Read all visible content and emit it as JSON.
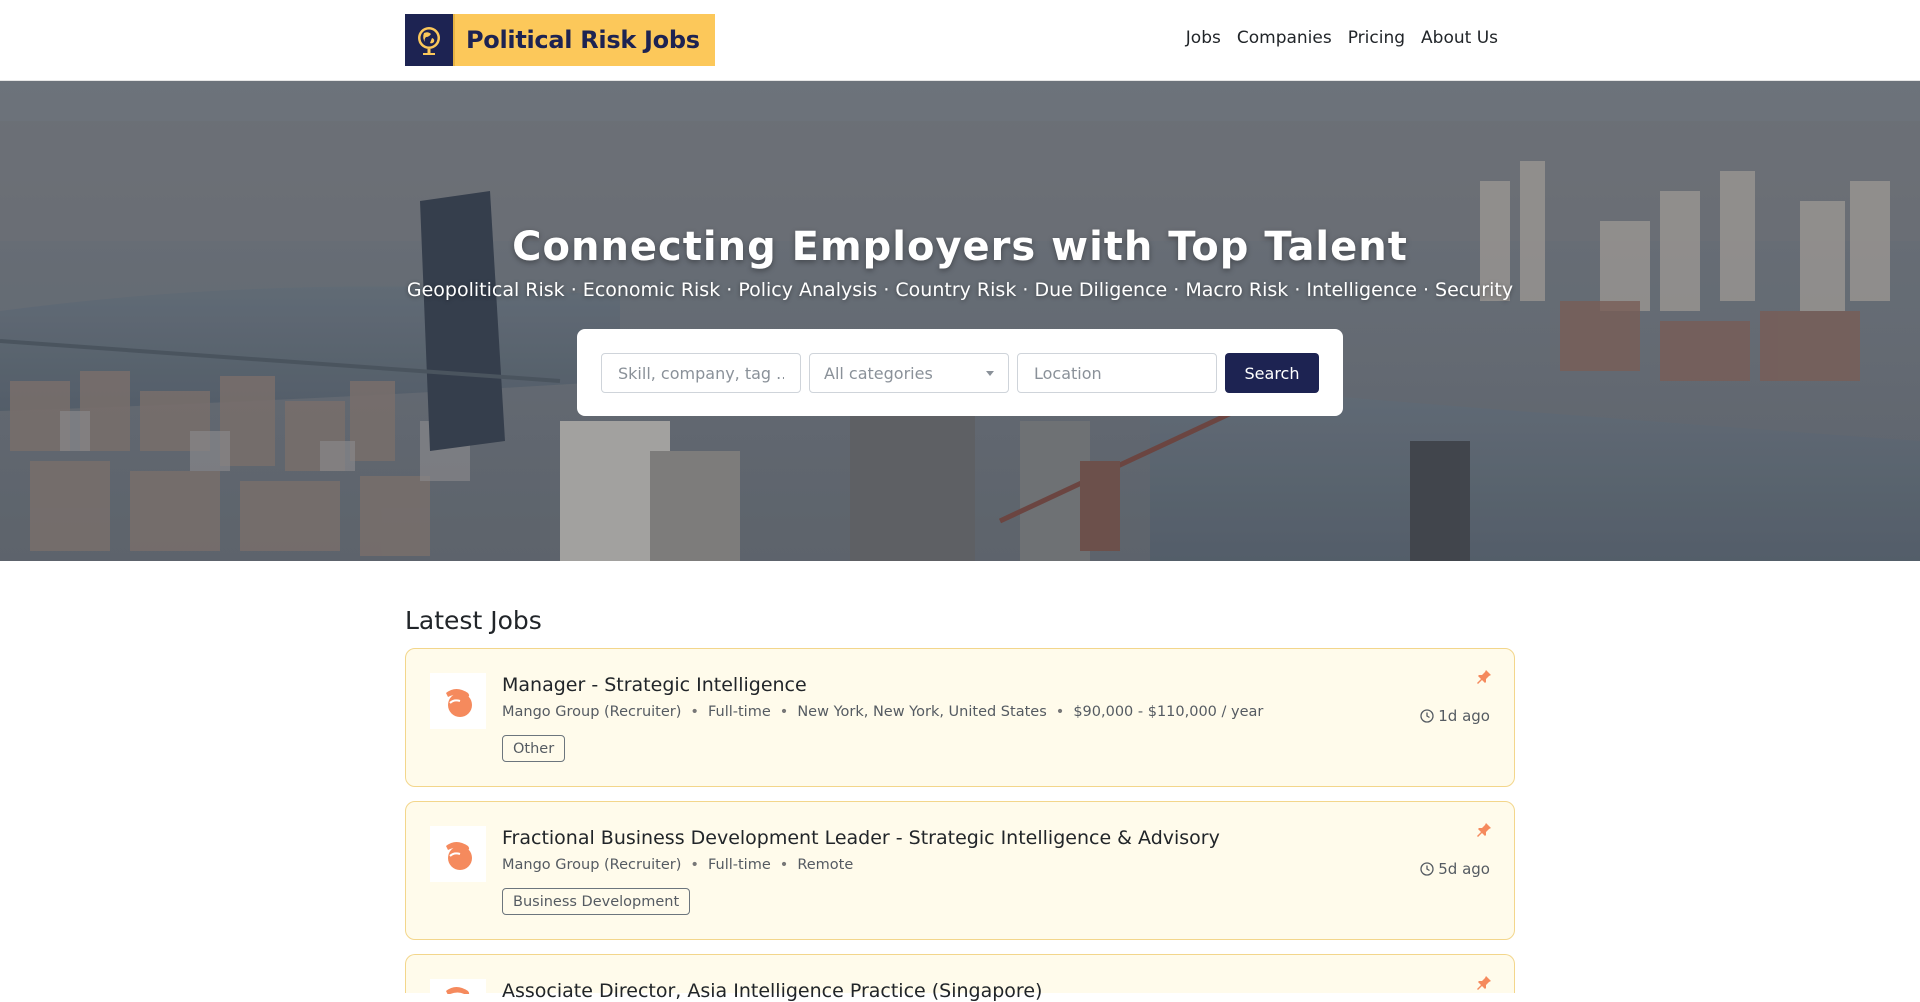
{
  "brand": {
    "name": "Political Risk Jobs",
    "logo_icon": "globe-icon"
  },
  "nav": [
    {
      "label": "Jobs"
    },
    {
      "label": "Companies"
    },
    {
      "label": "Pricing"
    },
    {
      "label": "About Us"
    }
  ],
  "hero": {
    "title": "Connecting Employers with Top Talent",
    "subtitle": "Geopolitical Risk · Economic Risk · Policy Analysis · Country Risk · Due Diligence · Macro Risk · Intelligence · Security"
  },
  "search": {
    "keyword_placeholder": "Skill, company, tag ...",
    "category_value": "All categories",
    "location_placeholder": "Location",
    "button_label": "Search"
  },
  "jobs_section": {
    "title": "Latest Jobs",
    "jobs": [
      {
        "title": "Manager - Strategic Intelligence",
        "company": "Mango Group (Recruiter)",
        "type": "Full-time",
        "location": "New York, New York, United States",
        "salary": "$90,000 - $110,000 / year",
        "tag": "Other",
        "posted": "1d ago"
      },
      {
        "title": "Fractional Business Development Leader - Strategic Intelligence & Advisory",
        "company": "Mango Group (Recruiter)",
        "type": "Full-time",
        "location": "Remote",
        "tag": "Business Development",
        "posted": "5d ago"
      },
      {
        "title": "Associate Director, Asia Intelligence Practice (Singapore)"
      }
    ]
  },
  "colors": {
    "brand_yellow": "#fcc85a",
    "navy": "#1d2352",
    "card_bg": "#fffbeb",
    "card_border": "#f3d68b",
    "pin_orange": "#f58a5d"
  }
}
